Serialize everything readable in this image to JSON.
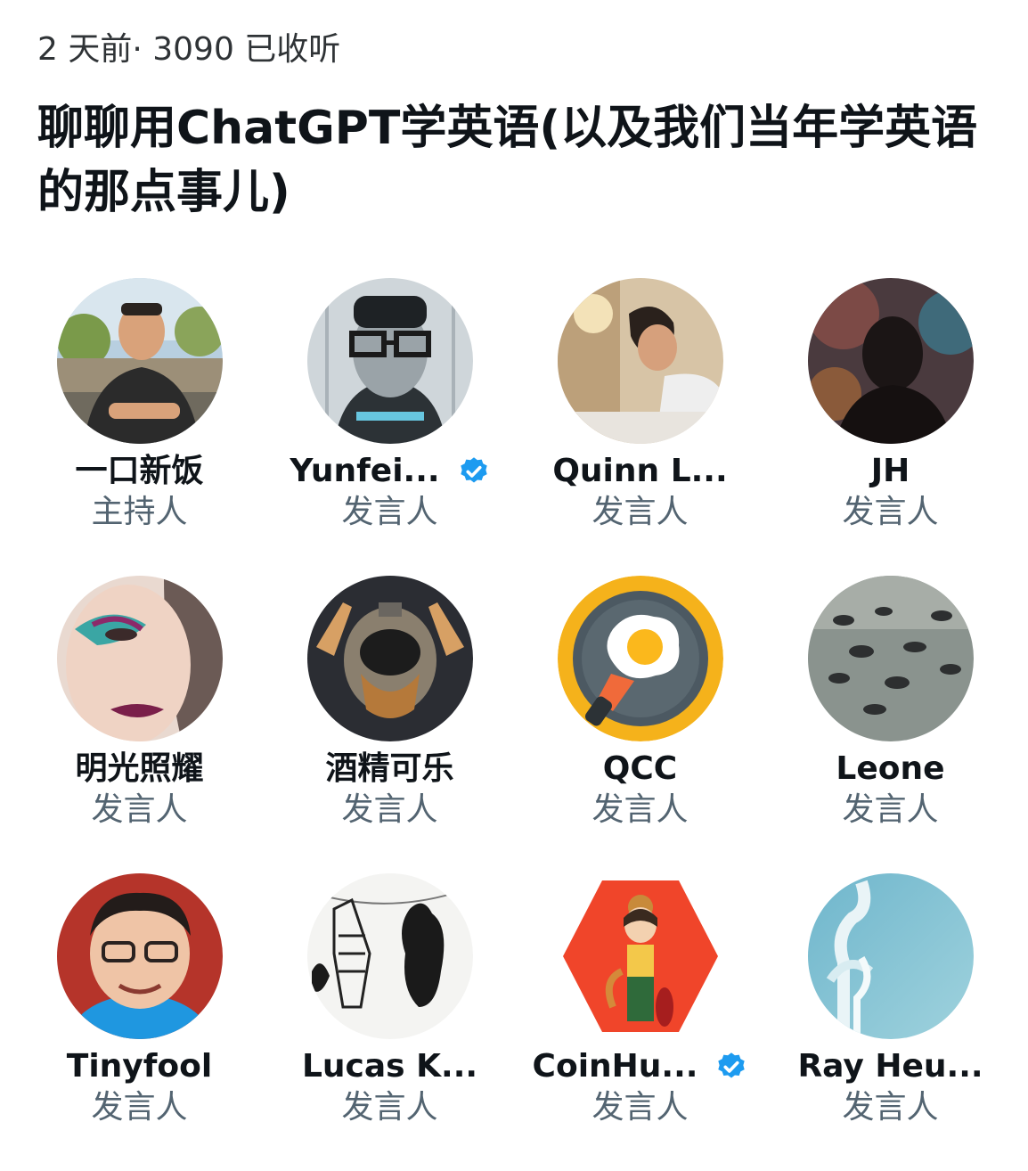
{
  "space": {
    "meta": "2 天前· 3090 已收听",
    "title": "聊聊用ChatGPT学英语(以及我们当年学英语的那点事儿)"
  },
  "colors": {
    "verified": "#1d9bf0",
    "name": "#0f1419",
    "role": "#536471"
  },
  "speakers": [
    {
      "name": "一口新饭",
      "role": "主持人",
      "verified": false,
      "avatar": "person-outdoor-avatar"
    },
    {
      "name": "Yunfei...",
      "role": "发言人",
      "verified": true,
      "avatar": "illustrated-glasses-avatar"
    },
    {
      "name": "Quinn L...",
      "role": "发言人",
      "verified": false,
      "avatar": "person-writing-avatar"
    },
    {
      "name": "JH",
      "role": "发言人",
      "verified": false,
      "avatar": "silhouette-avatar"
    },
    {
      "name": "明光照耀",
      "role": "发言人",
      "verified": false,
      "avatar": "makeup-face-avatar"
    },
    {
      "name": "酒精可乐",
      "role": "发言人",
      "verified": false,
      "avatar": "astronaut-avatar"
    },
    {
      "name": "QCC",
      "role": "发言人",
      "verified": false,
      "avatar": "fried-egg-pan-avatar"
    },
    {
      "name": "Leone",
      "role": "发言人",
      "verified": false,
      "avatar": "ducks-water-avatar"
    },
    {
      "name": "Tinyfool",
      "role": "发言人",
      "verified": false,
      "avatar": "person-glasses-avatar"
    },
    {
      "name": "Lucas K...",
      "role": "发言人",
      "verified": false,
      "avatar": "cats-sketch-avatar"
    },
    {
      "name": "CoinHu...",
      "role": "发言人",
      "verified": true,
      "avatar": "cartoon-girl-hexagon-avatar"
    },
    {
      "name": "Ray Heu...",
      "role": "发言人",
      "verified": false,
      "avatar": "blue-sculpture-avatar"
    }
  ]
}
